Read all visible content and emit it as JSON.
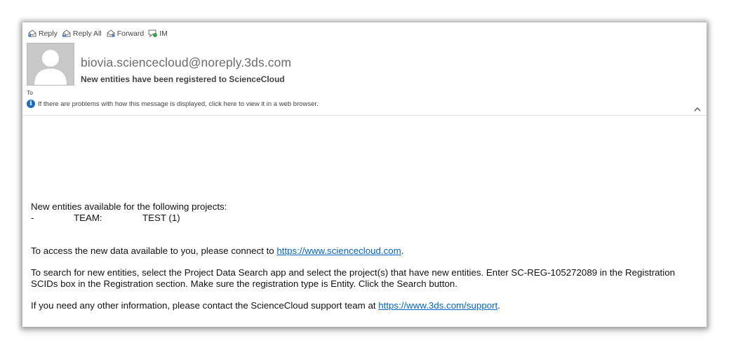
{
  "toolbar": {
    "reply": "Reply",
    "reply_all": "Reply All",
    "forward": "Forward",
    "im": "IM"
  },
  "header": {
    "sender": "biovia.sciencecloud@noreply.3ds.com",
    "subject": "New entities have been registered to ScienceCloud",
    "to_label": "To",
    "info_message": "If there are problems with how this message is displayed, click here to view it in a web browser."
  },
  "body": {
    "intro": "New entities available for the following projects:",
    "team_row": [
      "-",
      "TEAM:",
      "TEST (1)"
    ],
    "access_text": "To access the new data available to you, please connect to ",
    "access_link": "https://www.sciencecloud.com",
    "access_end": ".",
    "search_text": "To search for new entities, select the Project Data Search app and select the project(s) that have new entities. Enter SC-REG-105272089 in the Registration SCIDs box in the Registration section. Make sure the registration type is Entity. Click the Search button.",
    "contact_text": "If you need any other information, please contact the ScienceCloud support team at ",
    "contact_link": "https://www.3ds.com/support",
    "contact_end": "."
  },
  "colors": {
    "link": "#0563c1",
    "info_icon": "#1e6bbf",
    "avatar_bg": "#c8c8c8"
  },
  "icons": [
    "reply-icon",
    "reply-all-icon",
    "forward-icon",
    "im-icon",
    "avatar-placeholder-icon",
    "info-icon",
    "chevron-up-icon"
  ]
}
